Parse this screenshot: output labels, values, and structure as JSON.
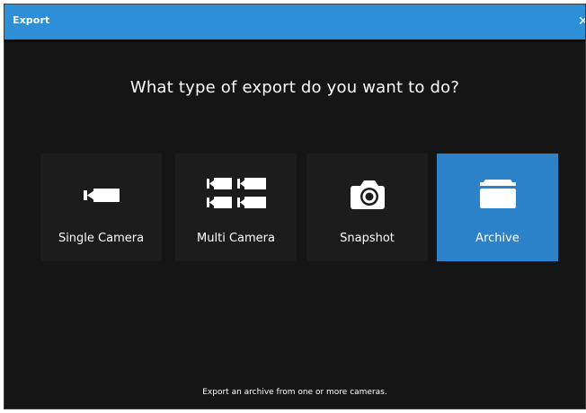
{
  "window": {
    "title": "Export",
    "close_glyph": "✕"
  },
  "prompt": {
    "question": "What type of export do you want to do?"
  },
  "options": [
    {
      "label": "Single Camera",
      "icon": "single-camera-icon",
      "selected": false
    },
    {
      "label": "Multi Camera",
      "icon": "multi-camera-icon",
      "selected": false
    },
    {
      "label": "Snapshot",
      "icon": "snapshot-camera-icon",
      "selected": false
    },
    {
      "label": "Archive",
      "icon": "archive-box-icon",
      "selected": true
    }
  ],
  "footer": {
    "description": "Export an archive from one or more cameras."
  },
  "colors": {
    "titlebar": "#2d8fd8",
    "background": "#151515",
    "tile": "#1c1c1c",
    "tile_selected": "#2c82c9",
    "text": "#ffffff"
  }
}
